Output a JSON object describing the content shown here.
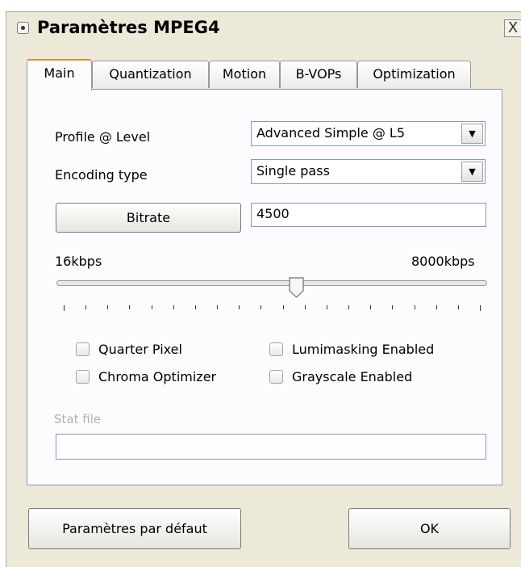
{
  "dialog": {
    "title": "Paramètres MPEG4",
    "close_glyph": "X"
  },
  "tabs": [
    {
      "label": "Main",
      "active": true
    },
    {
      "label": "Quantization",
      "active": false
    },
    {
      "label": "Motion",
      "active": false
    },
    {
      "label": "B-VOPs",
      "active": false
    },
    {
      "label": "Optimization",
      "active": false
    }
  ],
  "main": {
    "profile_label": "Profile @ Level",
    "profile_value": "Advanced Simple @ L5",
    "encoding_label": "Encoding type",
    "encoding_value": "Single pass",
    "bitrate_button": "Bitrate",
    "bitrate_value": "4500",
    "slider_min_label": "16kbps",
    "slider_max_label": "8000kbps",
    "slider_fraction": 0.56,
    "tick_count": 20,
    "checkboxes": {
      "quarter_pixel": "Quarter Pixel",
      "lumimasking": "Lumimasking Enabled",
      "chroma_optimizer": "Chroma Optimizer",
      "grayscale": "Grayscale Enabled"
    },
    "stat_file_label": "Stat file",
    "stat_file_value": ""
  },
  "footer": {
    "defaults_button": "Paramètres par défaut",
    "ok_button": "OK"
  },
  "icons": {
    "window": "window-menu-icon",
    "dropdown": "chevron-down-icon",
    "close": "close-icon"
  }
}
